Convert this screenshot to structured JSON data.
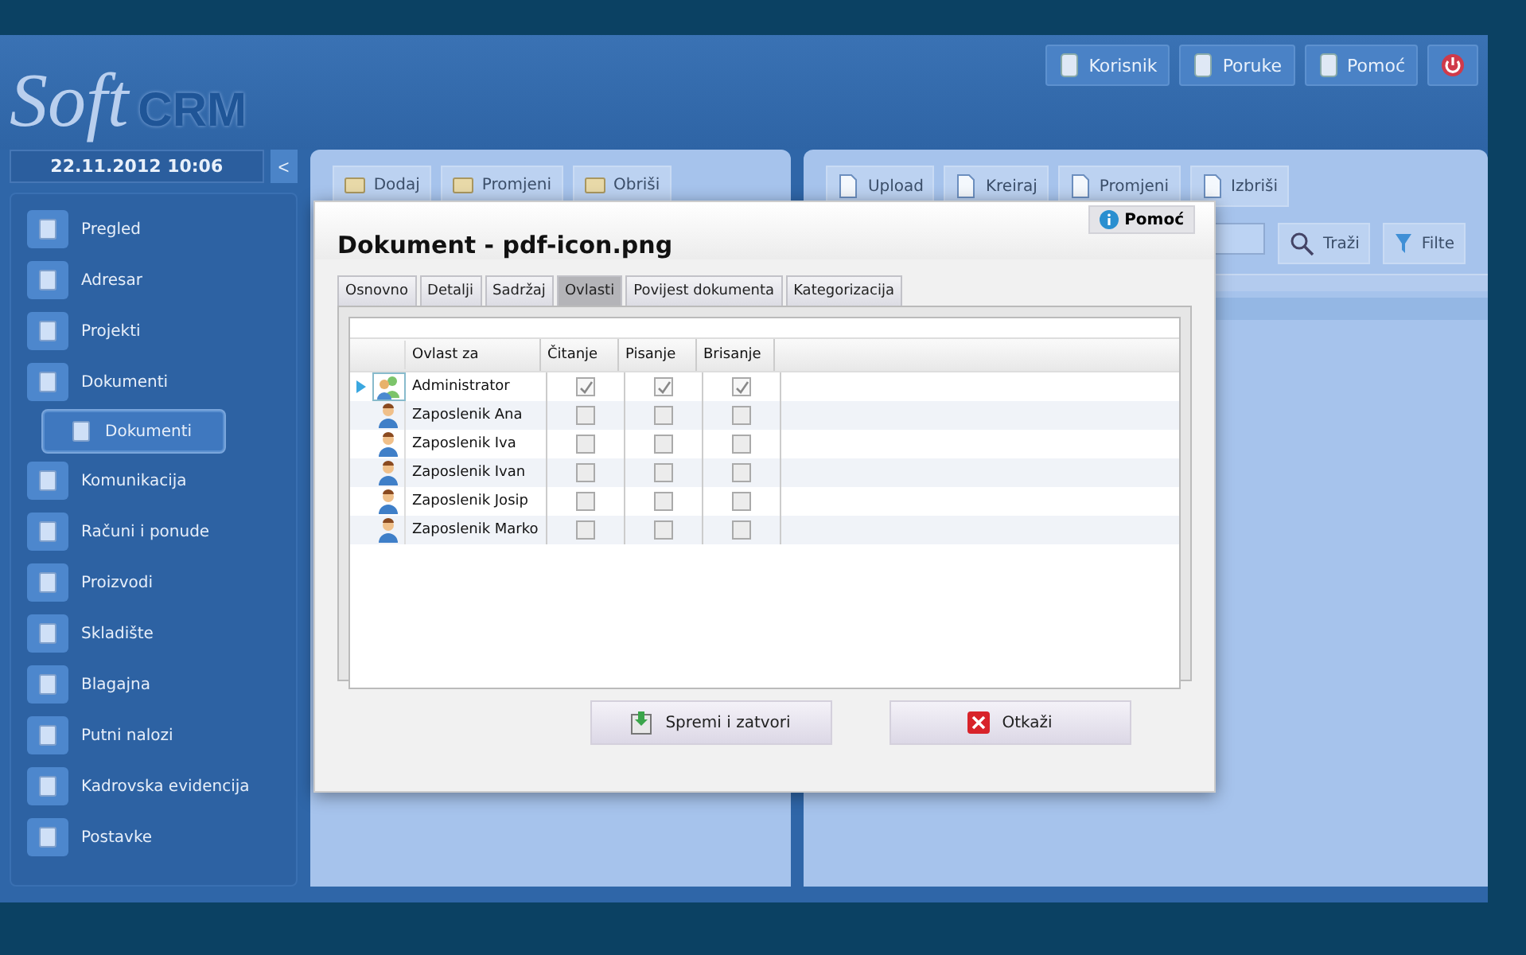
{
  "header": {
    "logo_script": "Soft",
    "logo_bold": "CRM",
    "buttons": [
      "Korisnik",
      "Poruke",
      "Pomoć"
    ]
  },
  "sidebar": {
    "date": "22.11.2012 10:06",
    "collapse": "<",
    "items": [
      {
        "label": "Pregled",
        "selected": false
      },
      {
        "label": "Adresar",
        "selected": false
      },
      {
        "label": "Projekti",
        "selected": false
      },
      {
        "label": "Dokumenti",
        "selected": false,
        "children": [
          {
            "label": "Dokumenti",
            "selected": true
          }
        ]
      },
      {
        "label": "Komunikacija",
        "selected": false
      },
      {
        "label": "Računi i ponude",
        "selected": false
      },
      {
        "label": "Proizvodi",
        "selected": false
      },
      {
        "label": "Skladište",
        "selected": false
      },
      {
        "label": "Blagajna",
        "selected": false
      },
      {
        "label": "Putni nalozi",
        "selected": false
      },
      {
        "label": "Kadrovska evidencija",
        "selected": false
      },
      {
        "label": "Postavke",
        "selected": false
      }
    ]
  },
  "left_panel": {
    "toolbar": [
      "Dodaj",
      "Promjeni",
      "Obriši"
    ]
  },
  "right_panel": {
    "toolbar": [
      "Upload",
      "Kreiraj",
      "Promjeni",
      "Izbriši"
    ],
    "search_button": "Traži",
    "filter_button": "Filte"
  },
  "dialog": {
    "title": "Dokument - pdf-icon.png",
    "help": "Pomoć",
    "tabs": [
      {
        "label": "Osnovno",
        "selected": false
      },
      {
        "label": "Detalji",
        "selected": false
      },
      {
        "label": "Sadržaj",
        "selected": false
      },
      {
        "label": "Ovlasti",
        "selected": true
      },
      {
        "label": "Povijest dokumenta",
        "selected": false
      },
      {
        "label": "Kategorizacija",
        "selected": false
      }
    ],
    "columns": [
      "Ovlast za",
      "Čitanje",
      "Pisanje",
      "Brisanje"
    ],
    "rows": [
      {
        "kind": "group",
        "name": "Administrator",
        "selected": true,
        "read": true,
        "write": true,
        "delete": true
      },
      {
        "kind": "user",
        "name": "Zaposlenik Ana",
        "selected": false,
        "read": false,
        "write": false,
        "delete": false
      },
      {
        "kind": "user",
        "name": "Zaposlenik Iva",
        "selected": false,
        "read": false,
        "write": false,
        "delete": false
      },
      {
        "kind": "user",
        "name": "Zaposlenik Ivan",
        "selected": false,
        "read": false,
        "write": false,
        "delete": false
      },
      {
        "kind": "user",
        "name": "Zaposlenik Josip",
        "selected": false,
        "read": false,
        "write": false,
        "delete": false
      },
      {
        "kind": "user",
        "name": "Zaposlenik Marko",
        "selected": false,
        "read": false,
        "write": false,
        "delete": false
      }
    ],
    "save": "Spremi i zatvori",
    "cancel": "Otkaži"
  }
}
